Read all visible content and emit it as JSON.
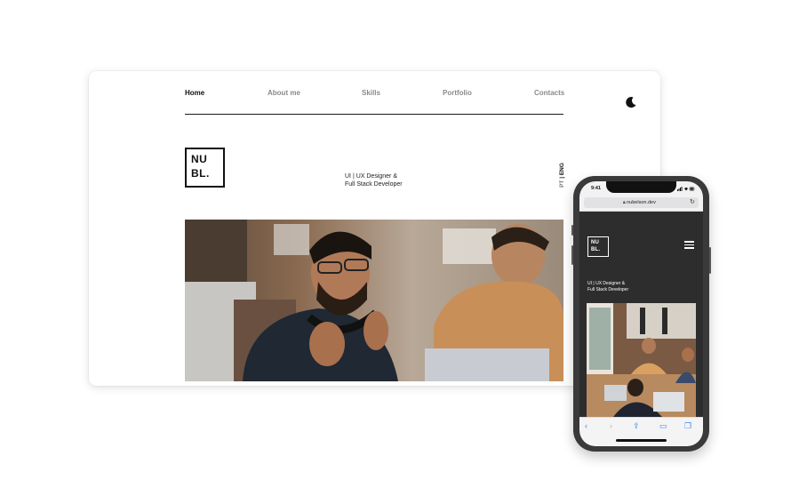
{
  "desktop": {
    "nav": [
      {
        "label": "Home",
        "active": true
      },
      {
        "label": "About me",
        "active": false
      },
      {
        "label": "Skills",
        "active": false
      },
      {
        "label": "Portfolio",
        "active": false
      },
      {
        "label": "Contacts",
        "active": false
      }
    ],
    "theme_toggle_icon": "moon-icon",
    "logo": {
      "line1": "NU",
      "line2": "BL."
    },
    "tagline": {
      "line1": "UI | UX Designer &",
      "line2": "Full Stack Developer"
    },
    "language": {
      "pt": "PT",
      "separator": " | ",
      "eng": "ENG"
    },
    "hero_image": "photo-two-developers-at-laptops"
  },
  "phone": {
    "status": {
      "time": "9:41"
    },
    "url": "nubelson.dev",
    "logo": {
      "line1": "NU",
      "line2": "BL."
    },
    "menu_icon": "hamburger-icon",
    "tagline": {
      "line1": "UI | UX Designer &",
      "line2": "Full Stack Developer"
    },
    "hero_image": "photo-team-working-in-office",
    "toolbar": {
      "back": "‹",
      "forward": "›",
      "share": "⇪",
      "bookmarks": "▭",
      "tabs": "❐"
    }
  },
  "colors": {
    "accent_ios": "#3b82f6",
    "phone_bg": "#2d2d2d",
    "text_dark": "#111111",
    "nav_inactive": "#8a8a8a"
  }
}
